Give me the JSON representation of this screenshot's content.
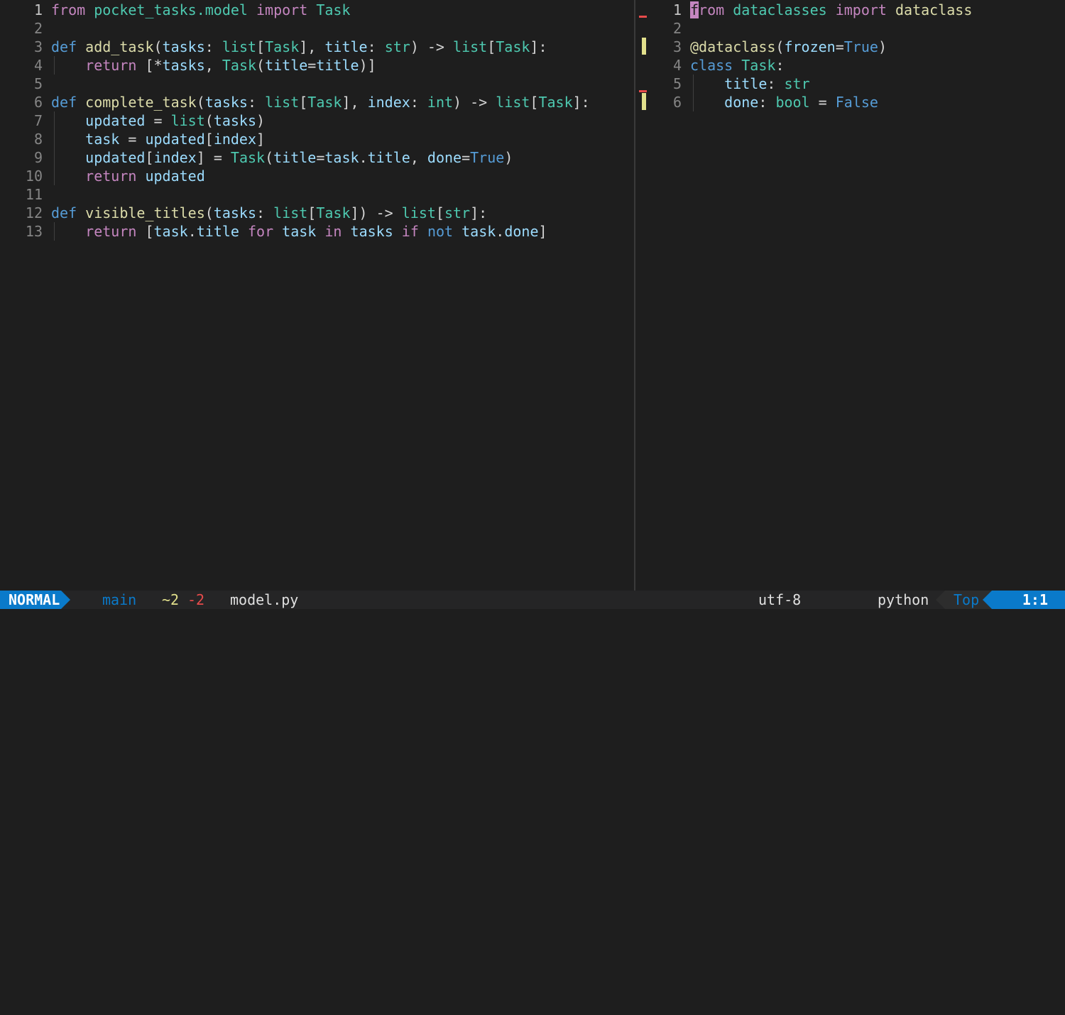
{
  "editor": {
    "left_pane": {
      "lines": [
        {
          "num": "1",
          "tokens": [
            [
              "kw",
              "from"
            ],
            [
              "pl",
              " "
            ],
            [
              "mod",
              "pocket_tasks.model"
            ],
            [
              "pl",
              " "
            ],
            [
              "kw",
              "import"
            ],
            [
              "pl",
              " "
            ],
            [
              "cls",
              "Task"
            ]
          ]
        },
        {
          "num": "2",
          "tokens": []
        },
        {
          "num": "3",
          "tokens": [
            [
              "kw2",
              "def"
            ],
            [
              "pl",
              " "
            ],
            [
              "fn",
              "add_task"
            ],
            [
              "pl",
              "("
            ],
            [
              "param",
              "tasks"
            ],
            [
              "pl",
              ": "
            ],
            [
              "cls",
              "list"
            ],
            [
              "pl",
              "["
            ],
            [
              "cls",
              "Task"
            ],
            [
              "pl",
              "], "
            ],
            [
              "param",
              "title"
            ],
            [
              "pl",
              ": "
            ],
            [
              "cls",
              "str"
            ],
            [
              "pl",
              ") -> "
            ],
            [
              "cls",
              "list"
            ],
            [
              "pl",
              "["
            ],
            [
              "cls",
              "Task"
            ],
            [
              "pl",
              "]:"
            ]
          ]
        },
        {
          "num": "4",
          "tokens": [
            [
              "pl",
              "    "
            ],
            [
              "kw",
              "return"
            ],
            [
              "pl",
              " [*"
            ],
            [
              "param",
              "tasks"
            ],
            [
              "pl",
              ", "
            ],
            [
              "cls",
              "Task"
            ],
            [
              "pl",
              "("
            ],
            [
              "param",
              "title"
            ],
            [
              "pl",
              "="
            ],
            [
              "param",
              "title"
            ],
            [
              "pl",
              ")]"
            ]
          ]
        },
        {
          "num": "5",
          "tokens": []
        },
        {
          "num": "6",
          "tokens": [
            [
              "kw2",
              "def"
            ],
            [
              "pl",
              " "
            ],
            [
              "fn",
              "complete_task"
            ],
            [
              "pl",
              "("
            ],
            [
              "param",
              "tasks"
            ],
            [
              "pl",
              ": "
            ],
            [
              "cls",
              "list"
            ],
            [
              "pl",
              "["
            ],
            [
              "cls",
              "Task"
            ],
            [
              "pl",
              "], "
            ],
            [
              "param",
              "index"
            ],
            [
              "pl",
              ": "
            ],
            [
              "cls",
              "int"
            ],
            [
              "pl",
              ") -> "
            ],
            [
              "cls",
              "list"
            ],
            [
              "pl",
              "["
            ],
            [
              "cls",
              "Task"
            ],
            [
              "pl",
              "]:"
            ]
          ]
        },
        {
          "num": "7",
          "tokens": [
            [
              "pl",
              "    "
            ],
            [
              "param",
              "updated"
            ],
            [
              "pl",
              " = "
            ],
            [
              "cls",
              "list"
            ],
            [
              "pl",
              "("
            ],
            [
              "param",
              "tasks"
            ],
            [
              "pl",
              ")"
            ]
          ]
        },
        {
          "num": "8",
          "tokens": [
            [
              "pl",
              "    "
            ],
            [
              "param",
              "task"
            ],
            [
              "pl",
              " = "
            ],
            [
              "param",
              "updated"
            ],
            [
              "pl",
              "["
            ],
            [
              "param",
              "index"
            ],
            [
              "pl",
              "]"
            ]
          ]
        },
        {
          "num": "9",
          "tokens": [
            [
              "pl",
              "    "
            ],
            [
              "param",
              "updated"
            ],
            [
              "pl",
              "["
            ],
            [
              "param",
              "index"
            ],
            [
              "pl",
              "] = "
            ],
            [
              "cls",
              "Task"
            ],
            [
              "pl",
              "("
            ],
            [
              "param",
              "title"
            ],
            [
              "pl",
              "="
            ],
            [
              "param",
              "task"
            ],
            [
              "pl",
              "."
            ],
            [
              "param",
              "title"
            ],
            [
              "pl",
              ", "
            ],
            [
              "param",
              "done"
            ],
            [
              "pl",
              "="
            ],
            [
              "const",
              "True"
            ],
            [
              "pl",
              ")"
            ]
          ]
        },
        {
          "num": "10",
          "tokens": [
            [
              "pl",
              "    "
            ],
            [
              "kw",
              "return"
            ],
            [
              "pl",
              " "
            ],
            [
              "param",
              "updated"
            ]
          ]
        },
        {
          "num": "11",
          "tokens": []
        },
        {
          "num": "12",
          "tokens": [
            [
              "kw2",
              "def"
            ],
            [
              "pl",
              " "
            ],
            [
              "fn",
              "visible_titles"
            ],
            [
              "pl",
              "("
            ],
            [
              "param",
              "tasks"
            ],
            [
              "pl",
              ": "
            ],
            [
              "cls",
              "list"
            ],
            [
              "pl",
              "["
            ],
            [
              "cls",
              "Task"
            ],
            [
              "pl",
              "]) -> "
            ],
            [
              "cls",
              "list"
            ],
            [
              "pl",
              "["
            ],
            [
              "cls",
              "str"
            ],
            [
              "pl",
              "]:"
            ]
          ]
        },
        {
          "num": "13",
          "tokens": [
            [
              "pl",
              "    "
            ],
            [
              "kw",
              "return"
            ],
            [
              "pl",
              " ["
            ],
            [
              "param",
              "task"
            ],
            [
              "pl",
              "."
            ],
            [
              "param",
              "title"
            ],
            [
              "pl",
              " "
            ],
            [
              "kw",
              "for"
            ],
            [
              "pl",
              " "
            ],
            [
              "param",
              "task"
            ],
            [
              "pl",
              " "
            ],
            [
              "kw",
              "in"
            ],
            [
              "pl",
              " "
            ],
            [
              "param",
              "tasks"
            ],
            [
              "pl",
              " "
            ],
            [
              "kw",
              "if"
            ],
            [
              "pl",
              " "
            ],
            [
              "kw2",
              "not"
            ],
            [
              "pl",
              " "
            ],
            [
              "param",
              "task"
            ],
            [
              "pl",
              "."
            ],
            [
              "param",
              "done"
            ],
            [
              "pl",
              "]"
            ]
          ]
        }
      ]
    },
    "right_pane": {
      "lines": [
        {
          "num": "1",
          "tokens": [
            [
              "cursor",
              "f"
            ],
            [
              "kw",
              "rom"
            ],
            [
              "pl",
              " "
            ],
            [
              "mod",
              "dataclasses"
            ],
            [
              "pl",
              " "
            ],
            [
              "kw",
              "import"
            ],
            [
              "pl",
              " "
            ],
            [
              "fn",
              "dataclass"
            ]
          ]
        },
        {
          "num": "2",
          "tokens": []
        },
        {
          "num": "3",
          "tokens": [
            [
              "fn",
              "@dataclass"
            ],
            [
              "pl",
              "("
            ],
            [
              "param",
              "frozen"
            ],
            [
              "pl",
              "="
            ],
            [
              "const",
              "True"
            ],
            [
              "pl",
              ")"
            ]
          ]
        },
        {
          "num": "4",
          "tokens": [
            [
              "kw2",
              "class"
            ],
            [
              "pl",
              " "
            ],
            [
              "cls",
              "Task"
            ],
            [
              "pl",
              ":"
            ]
          ]
        },
        {
          "num": "5",
          "tokens": [
            [
              "pl",
              "    "
            ],
            [
              "param",
              "title"
            ],
            [
              "pl",
              ": "
            ],
            [
              "cls",
              "str"
            ]
          ]
        },
        {
          "num": "6",
          "tokens": [
            [
              "pl",
              "    "
            ],
            [
              "param",
              "done"
            ],
            [
              "pl",
              ": "
            ],
            [
              "cls",
              "bool"
            ],
            [
              "pl",
              " = "
            ],
            [
              "const",
              "False"
            ]
          ]
        }
      ]
    }
  },
  "statusline": {
    "mode": "NORMAL",
    "branch_icon": "git-branch-icon",
    "branch": "main",
    "changed": "~2",
    "removed": "-2",
    "filename": "model.py",
    "encoding": "utf-8",
    "os_icon": "linux-icon",
    "filetype_icon": "python-icon",
    "filetype": "python",
    "position": "Top",
    "cursor": "1:1",
    "colors": {
      "accent": "#0a7aca",
      "changed": "#e2e08c",
      "removed": "#e84b4b",
      "python_yellow": "#f5c518"
    }
  }
}
